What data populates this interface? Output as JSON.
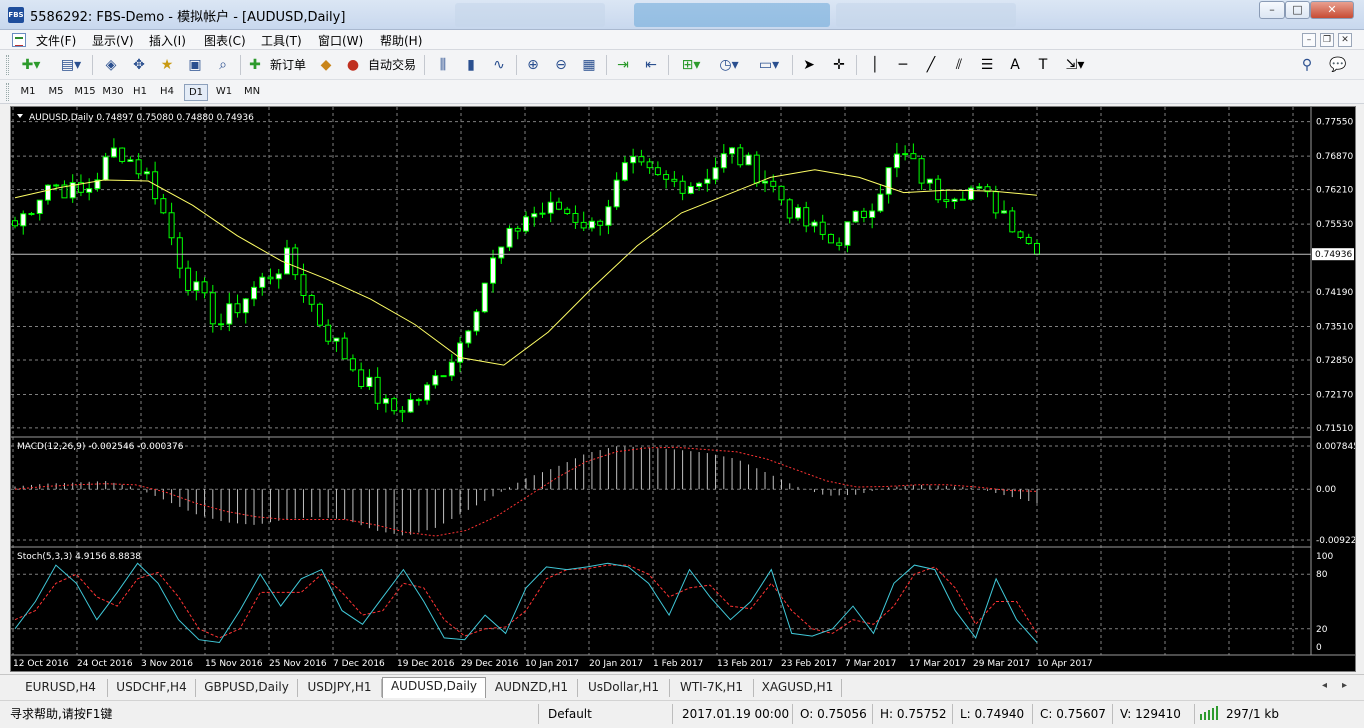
{
  "window": {
    "title": "5586292: FBS-Demo - 模拟帐户 - [AUDUSD,Daily]",
    "app_icon": "FBS",
    "controls": {
      "minimize": "–",
      "maximize": "□",
      "close": "✕"
    }
  },
  "menu": {
    "items": [
      "文件(F)",
      "显示(V)",
      "插入(I)",
      "图表(C)",
      "工具(T)",
      "窗口(W)",
      "帮助(H)"
    ],
    "mdi": {
      "minimize": "–",
      "restore": "❐",
      "close": "✕"
    }
  },
  "toolbar": {
    "new_order": "新订单",
    "auto_trading": "自动交易",
    "icons": [
      "new-chart-icon",
      "profiles-icon",
      "market-watch-icon",
      "navigator-icon",
      "data-window-icon",
      "terminal-icon",
      "tester-icon",
      "new-order-icon",
      "metaeditor-icon",
      "auto-trading-icon",
      "bar-chart-icon",
      "candlestick-icon",
      "line-chart-icon",
      "zoom-in-icon",
      "zoom-out-icon",
      "tile-windows-icon",
      "auto-scroll-icon",
      "chart-shift-icon",
      "indicators-icon",
      "periods-icon",
      "templates-icon",
      "cursor-icon",
      "crosshair-icon",
      "vertical-line-icon",
      "horizontal-line-icon",
      "trendline-icon",
      "equidistant-channel-icon",
      "fibonacci-icon",
      "text-icon",
      "text-label-icon",
      "arrows-icon",
      "search-icon",
      "chat-icon"
    ]
  },
  "timeframes": [
    "M1",
    "M5",
    "M15",
    "M30",
    "H1",
    "H4",
    "D1",
    "W1",
    "MN"
  ],
  "active_timeframe": "D1",
  "chart_data": {
    "type": "candlestick",
    "title": "AUDUSD,Daily  0.74897 0.75080 0.74880 0.74936",
    "price_axis_labels": [
      "0.77550",
      "0.76870",
      "0.76210",
      "0.75530",
      "0.74190",
      "0.73510",
      "0.72850",
      "0.72170",
      "0.71510"
    ],
    "ylim": [
      0.7141,
      0.7776
    ],
    "current_price": 0.74936,
    "current_price_label": "0.74936",
    "x_labels": [
      "12 Oct 2016",
      "24 Oct 2016",
      "3 Nov 2016",
      "15 Nov 2016",
      "25 Nov 2016",
      "7 Dec 2016",
      "19 Dec 2016",
      "29 Dec 2016",
      "10 Jan 2017",
      "20 Jan 2017",
      "1 Feb 2017",
      "13 Feb 2017",
      "23 Feb 2017",
      "7 Mar 2017",
      "17 Mar 2017",
      "29 Mar 2017",
      "10 Apr 2017"
    ],
    "approx_closes": [
      0.755,
      0.7635,
      0.761,
      0.7705,
      0.764,
      0.745,
      0.7355,
      0.7425,
      0.7485,
      0.7355,
      0.7265,
      0.7182,
      0.7215,
      0.731,
      0.7475,
      0.757,
      0.7585,
      0.7545,
      0.767,
      0.7635,
      0.7635,
      0.7695,
      0.7645,
      0.7562,
      0.7515,
      0.7582,
      0.7695,
      0.7615,
      0.7625,
      0.7582,
      0.7494
    ],
    "ma_line": [
      0.7605,
      0.7625,
      0.764,
      0.7638,
      0.759,
      0.753,
      0.748,
      0.7445,
      0.7405,
      0.7355,
      0.729,
      0.7275,
      0.734,
      0.7428,
      0.751,
      0.7575,
      0.761,
      0.7645,
      0.766,
      0.7645,
      0.7615,
      0.762,
      0.7618,
      0.761
    ],
    "macd": {
      "label": "MACD(12,26,9) -0.002546 -0.000376",
      "axis_labels": [
        "0.007845",
        "0.00",
        "-0.009223"
      ],
      "histogram": [
        0.0005,
        0.001,
        0.0012,
        0.0015,
        0.0003,
        -0.002,
        -0.0045,
        -0.006,
        -0.0065,
        -0.0055,
        -0.005,
        -0.0055,
        -0.0075,
        -0.0085,
        -0.007,
        -0.004,
        -0.001,
        0.002,
        0.004,
        0.0065,
        0.0078,
        0.0076,
        0.0072,
        0.0066,
        0.0055,
        0.003,
        0.0005,
        -0.0012,
        -0.001,
        0.0003,
        0.0008,
        0.0006,
        0.0002,
        -0.0012,
        -0.0025
      ],
      "signal": [
        0.0,
        0.0005,
        0.0008,
        0.001,
        0.0008,
        -0.0005,
        -0.0025,
        -0.004,
        -0.005,
        -0.0055,
        -0.0055,
        -0.0055,
        -0.0065,
        -0.0078,
        -0.0085,
        -0.0075,
        -0.005,
        -0.0015,
        0.002,
        0.005,
        0.0068,
        0.0075,
        0.0076,
        0.0072,
        0.0068,
        0.0055,
        0.0035,
        0.0015,
        0.0004,
        0.0005,
        0.0008,
        0.0008,
        0.0004,
        -0.0002,
        -0.0004
      ]
    },
    "stoch": {
      "label": "Stoch(5,3,3) 4.9156 8.8838",
      "axis_labels": [
        "100",
        "80",
        "20",
        "0"
      ],
      "main": [
        20,
        50,
        90,
        70,
        30,
        60,
        92,
        70,
        30,
        8,
        5,
        40,
        80,
        45,
        75,
        85,
        40,
        25,
        55,
        85,
        50,
        10,
        8,
        35,
        15,
        65,
        88,
        85,
        88,
        92,
        88,
        70,
        35,
        85,
        55,
        30,
        50,
        85,
        15,
        12,
        20,
        45,
        15,
        70,
        90,
        85,
        40,
        10,
        75,
        30,
        5
      ],
      "signal": [
        30,
        40,
        70,
        80,
        55,
        45,
        75,
        82,
        55,
        20,
        10,
        20,
        60,
        60,
        60,
        80,
        60,
        35,
        40,
        70,
        65,
        30,
        12,
        20,
        22,
        40,
        75,
        85,
        86,
        90,
        90,
        80,
        55,
        65,
        68,
        45,
        42,
        70,
        40,
        20,
        15,
        30,
        25,
        45,
        80,
        88,
        65,
        25,
        50,
        50,
        15
      ]
    }
  },
  "symbol_tabs": [
    "EURUSD,H4",
    "USDCHF,H4",
    "GBPUSD,Daily",
    "USDJPY,H1",
    "AUDUSD,Daily",
    "AUDNZD,H1",
    "UsDollar,H1",
    "WTI-7K,H1",
    "XAGUSD,H1"
  ],
  "active_symbol_tab": "AUDUSD,Daily",
  "status": {
    "help": "寻求帮助,请按F1键",
    "profile": "Default",
    "datetime": "2017.01.19 00:00",
    "open": "O: 0.75056",
    "high": "H: 0.75752",
    "low": "L: 0.74940",
    "close": "C: 0.75607",
    "volume": "V: 129410",
    "traffic": "297/1 kb"
  },
  "colors": {
    "chart_bg": "#000000",
    "bull_candle": "#ffffff",
    "bear_candle": "#000000",
    "candle_outline": "#00ff00",
    "ma_line": "#ffff66",
    "macd_hist": "#c0c0c0",
    "macd_signal": "#ff3333",
    "stoch_main": "#40c8d8",
    "stoch_signal": "#ff3333",
    "grid": "#7f7f7f"
  }
}
